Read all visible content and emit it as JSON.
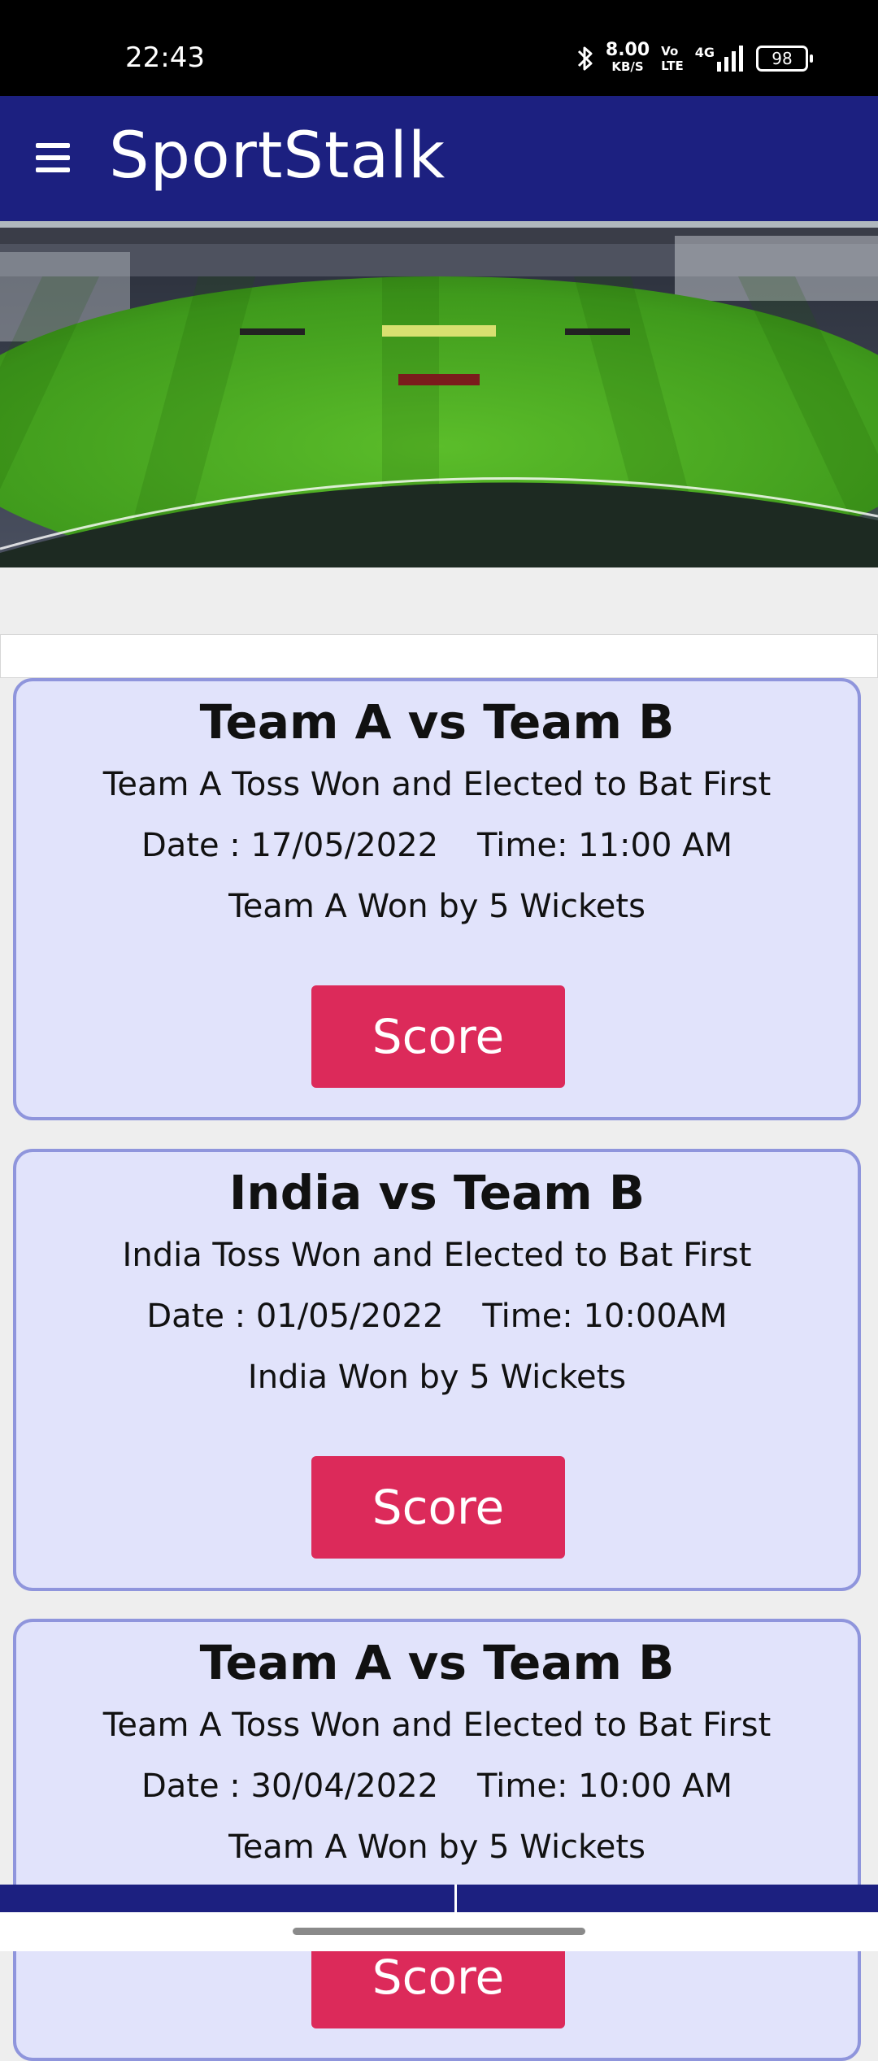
{
  "status_bar": {
    "time": "22:43",
    "net_speed": "8.00",
    "net_unit": "KB/S",
    "volte_top": "Vo",
    "volte_bottom": "LTE",
    "network": "4G",
    "battery": "98"
  },
  "app_bar": {
    "title": "SportStalk"
  },
  "colors": {
    "app_bar": "#1c2080",
    "card_bg": "#e1e3fb",
    "card_border": "#8f95dc",
    "score_button": "#dc2a5a"
  },
  "matches": [
    {
      "title": "Team A vs Team B",
      "toss": "Team A Toss Won and Elected to Bat First",
      "date": "Date : 17/05/2022",
      "time": "Time: 11:00 AM",
      "result": "Team A Won by 5 Wickets",
      "button_label": "Score"
    },
    {
      "title": "India vs Team B",
      "toss": "India Toss Won and Elected to Bat First",
      "date": "Date : 01/05/2022",
      "time": "Time: 10:00AM",
      "result": "India Won by 5 Wickets",
      "button_label": "Score"
    },
    {
      "title": "Team A vs Team B",
      "toss": "Team A Toss Won and Elected to Bat First",
      "date": "Date : 30/04/2022",
      "time": "Time: 10:00 AM",
      "result": "Team A Won by 5 Wickets",
      "button_label": "Score"
    }
  ]
}
